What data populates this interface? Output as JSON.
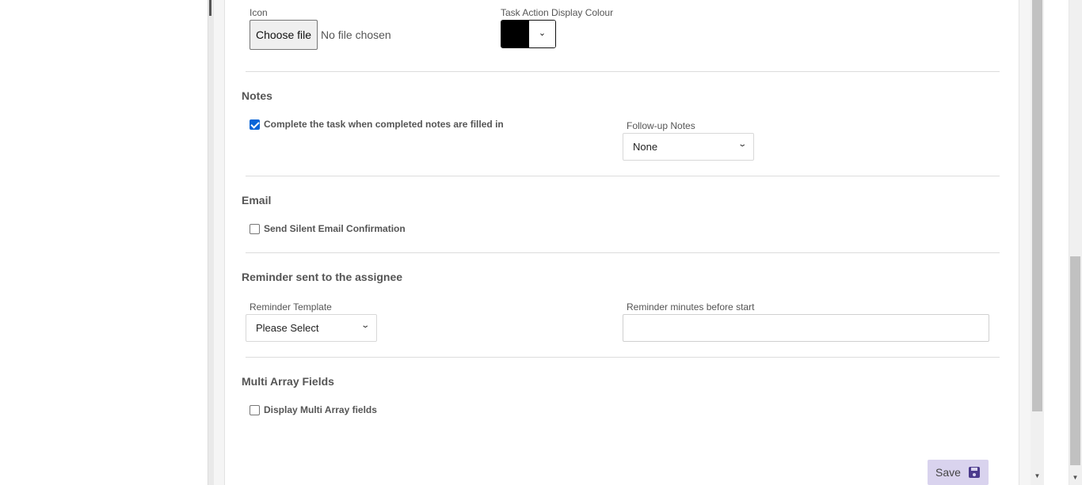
{
  "icon_section": {
    "icon_label": "Icon",
    "file_button_label": "Choose file",
    "file_status": "No file chosen",
    "colour_label": "Task Action Display Colour",
    "colour_value": "#000000"
  },
  "notes": {
    "title": "Notes",
    "complete_checkbox_label": "Complete the task when completed notes are filled in",
    "complete_checked": true,
    "followup_label": "Follow-up Notes",
    "followup_value": "None"
  },
  "email": {
    "title": "Email",
    "silent_label": "Send Silent Email Confirmation",
    "silent_checked": false
  },
  "reminder": {
    "title": "Reminder sent to the assignee",
    "template_label": "Reminder Template",
    "template_value": "Please Select",
    "minutes_label": "Reminder minutes before start",
    "minutes_value": ""
  },
  "multi_array": {
    "title": "Multi Array Fields",
    "display_label": "Display Multi Array fields",
    "display_checked": false
  },
  "actions": {
    "save_label": "Save"
  },
  "icons": {
    "caret": "chevron-down-icon",
    "save": "floppy-disk-icon"
  },
  "colors": {
    "save_button_bg": "#d9d3ee",
    "checkbox_checked": "#0a66d8"
  }
}
